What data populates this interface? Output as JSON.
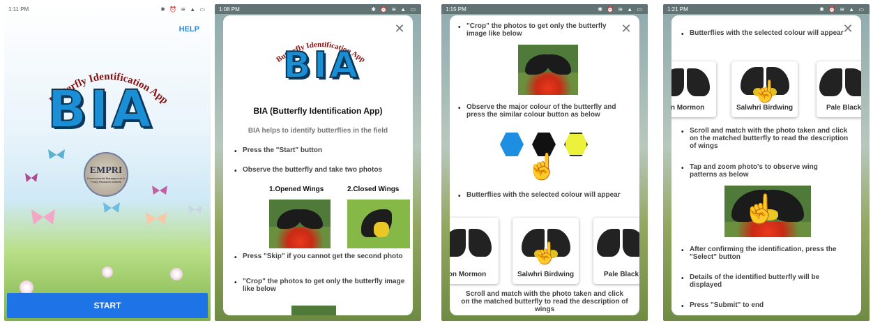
{
  "screens": [
    {
      "time": "1:11 PM",
      "help_label": "HELP",
      "app_title_arc": "Butterfly Identification App",
      "logo_text": "BIA",
      "partner_logo": "EMPRI",
      "partner_caption": "Environmental Management & Policy Research Institute",
      "start_label": "START"
    },
    {
      "time": "1:08 PM",
      "title": "BIA (Butterfly Identification App)",
      "intro": "BIA helps to identify butterflies in the field",
      "bullets": [
        "Press the \"Start\" button",
        "Observe the butterfly and take two photos",
        "Press \"Skip\" if you cannot get the second photo",
        "\"Crop\" the photos to get only the butterfly image like below"
      ],
      "photo_labels": [
        "1.Opened Wings",
        "2.Closed Wings"
      ]
    },
    {
      "time": "1:15 PM",
      "bullets": [
        "\"Crop\" the photos to get only the butterfly image like below",
        "Observe the major colour of the butterfly and press the similar colour button as below",
        "Butterflies with the selected colour will appear",
        "Scroll and match with the photo taken and click on the matched butterfly to read the description of wings"
      ],
      "tiles": [
        "on Mormon",
        "Salwhri Birdwing",
        "Pale Black"
      ],
      "colors": [
        "#1e8fe0",
        "#111111",
        "#ecf13b"
      ]
    },
    {
      "time": "1:21 PM",
      "bullets": [
        "Butterflies with the selected colour will appear",
        "Scroll and match with the photo taken and click on the matched butterfly to read the description of wings",
        "Tap and zoom photo's to observe wing patterns as below",
        "After confirming the identification, press the \"Select\" button",
        "Details of the identified butterfly will be displayed",
        "Press \"Submit\" to end"
      ],
      "tiles": [
        "on Mormon",
        "Salwhri Birdwing",
        "Pale Black"
      ]
    }
  ],
  "close_symbol": "✕",
  "status_icons": "✱ ⏰ ≋ ▲ ▭",
  "accent_color": "#1e74e6"
}
